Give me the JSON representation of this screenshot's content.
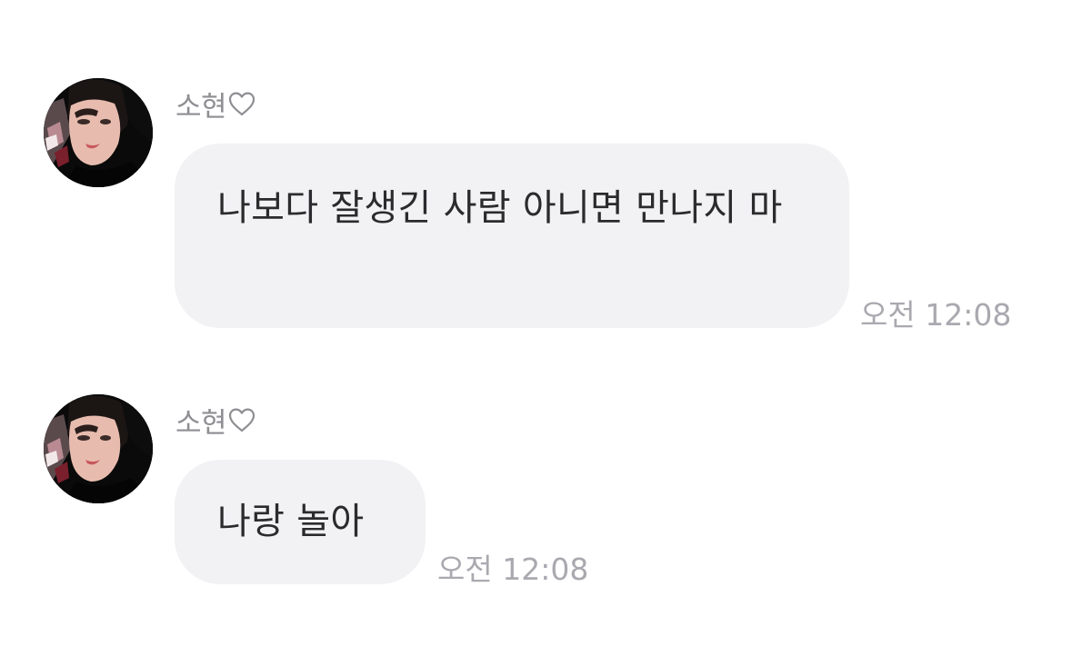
{
  "messages": [
    {
      "sender": "소현",
      "sender_icon": "heart-outline-icon",
      "avatar": "profile-photo",
      "text": "나보다 잘생긴 사람 아니면 만나지 마",
      "time": "오전 12:08"
    },
    {
      "sender": "소현",
      "sender_icon": "heart-outline-icon",
      "avatar": "profile-photo",
      "text": "나랑 놀아",
      "time": "오전 12:08"
    }
  ],
  "colors": {
    "background": "#ffffff",
    "bubble": "#f2f2f5",
    "message_text": "#2b2b2d",
    "sender_text": "#8e8e93",
    "timestamp_text": "#a9a9b0"
  }
}
